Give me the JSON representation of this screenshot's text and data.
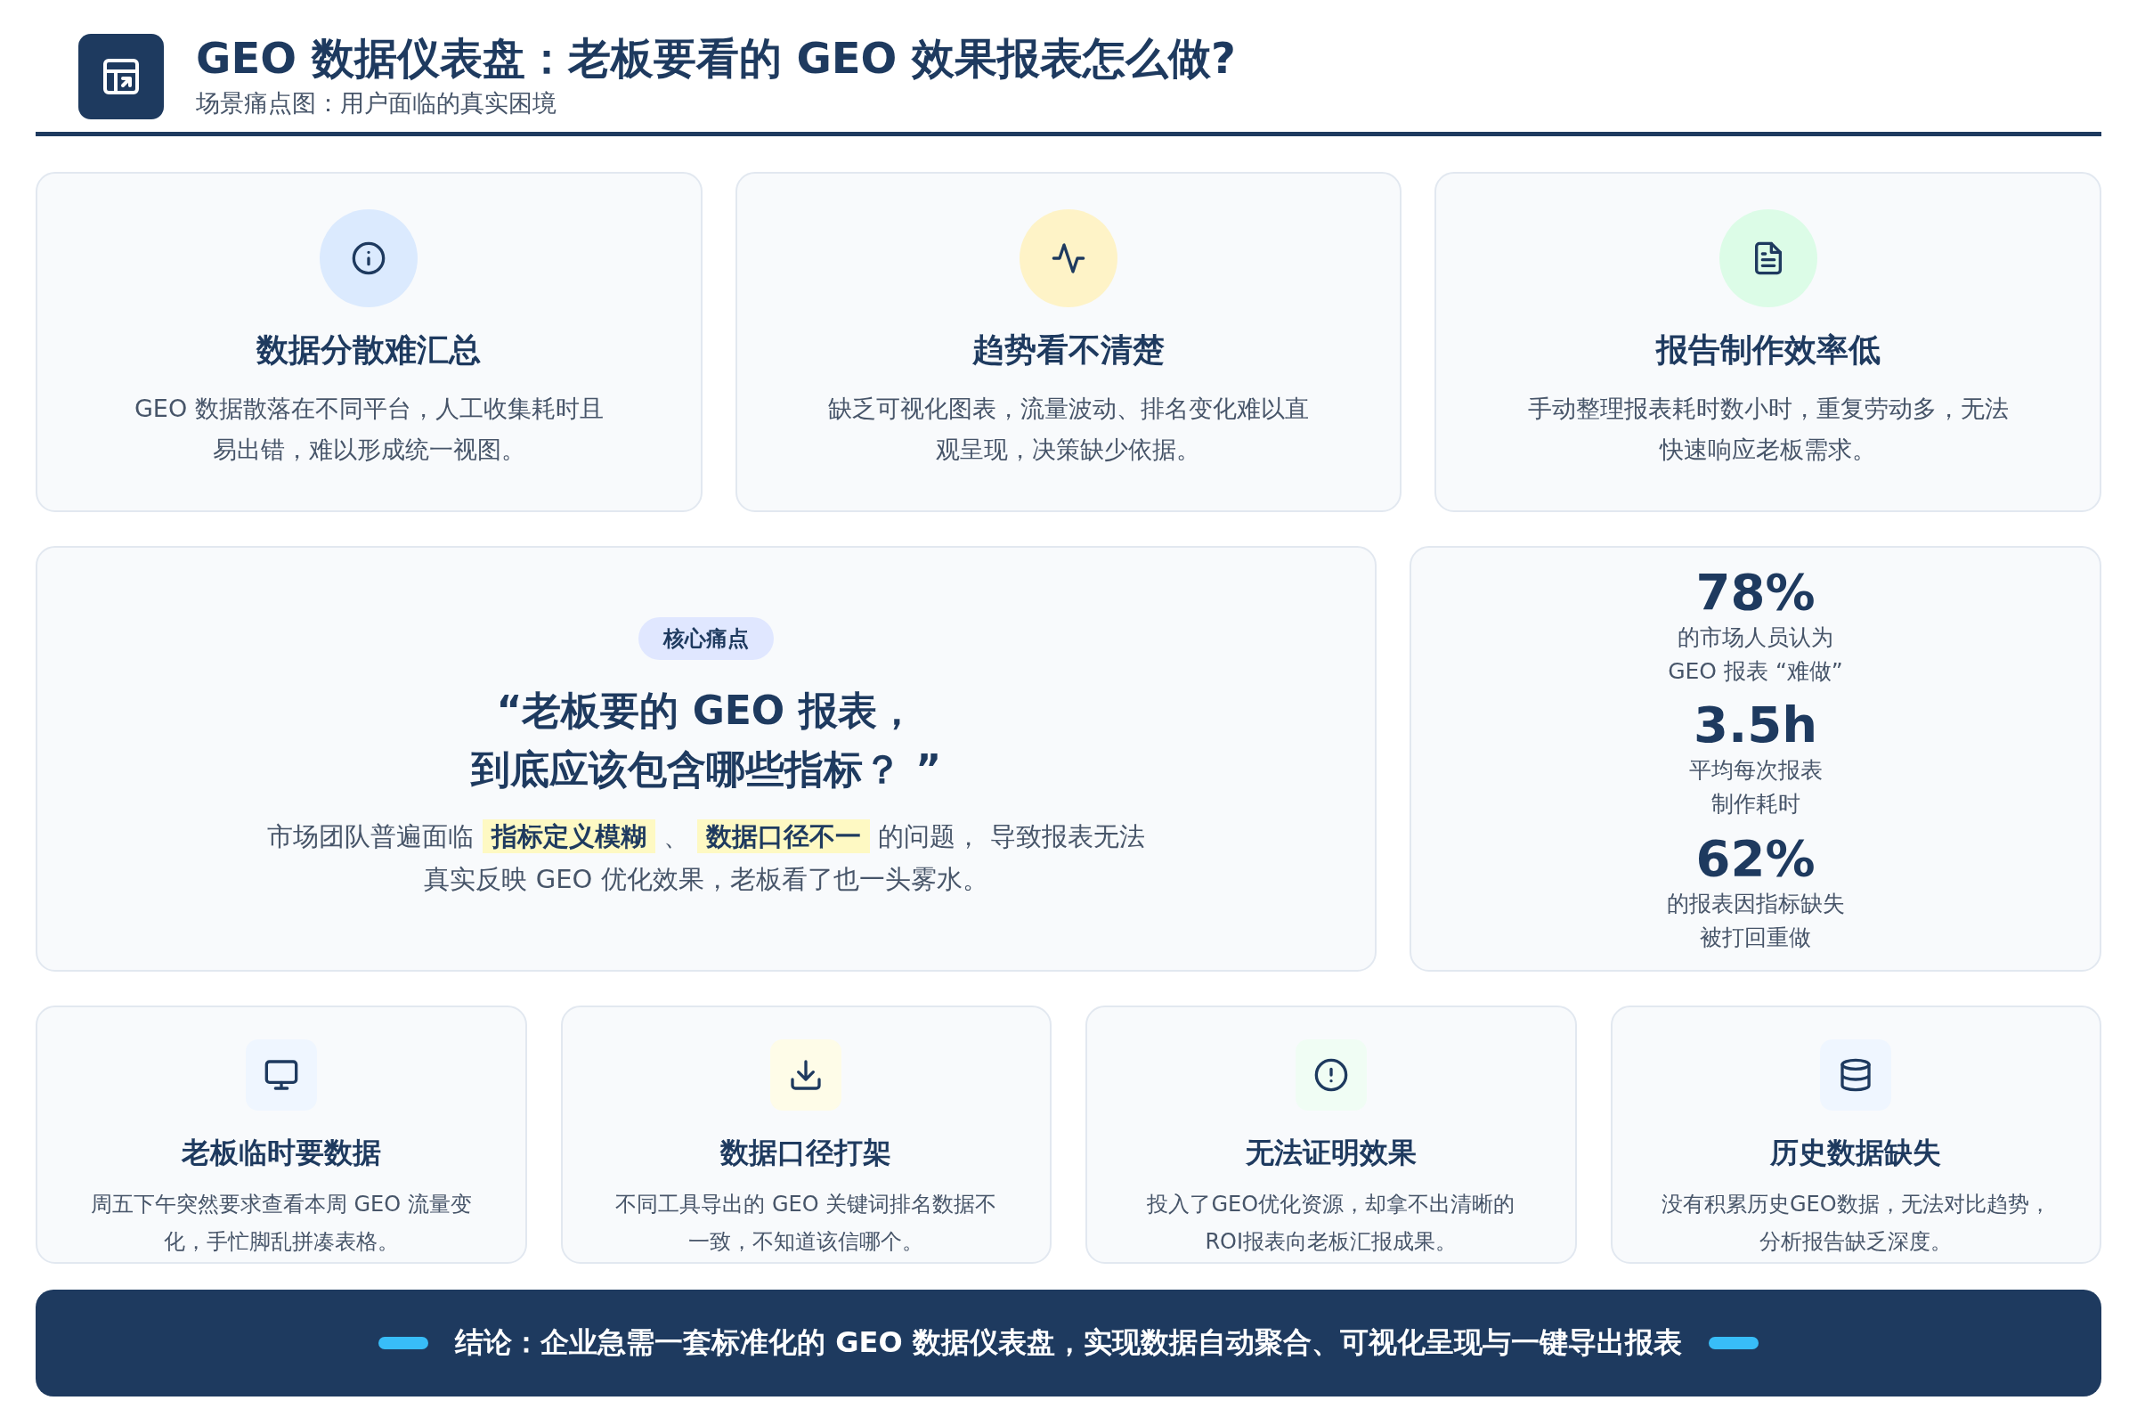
{
  "header": {
    "title": "GEO 数据仪表盘：老板要看的 GEO 效果报表怎么做?",
    "subtitle": "场景痛点图：用户面临的真实困境"
  },
  "pain_cards": [
    {
      "title": "数据分散难汇总",
      "description": "GEO 数据散落在不同平台，人工收集耗时且易出错，难以形成统一视图。"
    },
    {
      "title": "趋势看不清楚",
      "description": "缺乏可视化图表，流量波动、排名变化难以直观呈现，决策缺少依据。"
    },
    {
      "title": "报告制作效率低",
      "description": "手动整理报表耗时数小时，重复劳动多，无法快速响应老板需求。"
    }
  ],
  "core": {
    "badge": "核心痛点",
    "quote_lines": [
      "“老板要的 GEO 报表，",
      "到底应该包含哪些指标？ ”"
    ],
    "description": "市场团队普遍面临 **指标定义模糊** 、 **数据口径不一** 的问题， 导致报表无法真实反映 GEO 优化效果，老板看了也一头雾水。"
  },
  "stats": [
    {
      "value": "78%",
      "label_lines": [
        "的市场人员认为",
        "GEO 报表 “难做”"
      ]
    },
    {
      "value": "3.5h",
      "label_lines": [
        "平均每次报表",
        "制作耗时"
      ]
    },
    {
      "value": "62%",
      "label_lines": [
        "的报表因指标缺失",
        "被打回重做"
      ]
    }
  ],
  "scenarios": [
    {
      "title": "老板临时要数据",
      "description": "周五下午突然要求查看本周 GEO 流量变化，手忙脚乱拼凑表格。"
    },
    {
      "title": "数据口径打架",
      "description": "不同工具导出的 GEO 关键词排名数据不一致，不知道该信哪个。"
    },
    {
      "title": "无法证明效果",
      "description": "投入了GEO优化资源，却拿不出清晰的ROI报表向老板汇报成果。"
    },
    {
      "title": "历史数据缺失",
      "description": "没有积累历史GEO数据，无法对比趋势，分析报告缺乏深度。"
    }
  ],
  "conclusion": "结论：企业急需一套标准化的 GEO 数据仪表盘，实现数据自动聚合、可视化呈现与一键导出报表"
}
